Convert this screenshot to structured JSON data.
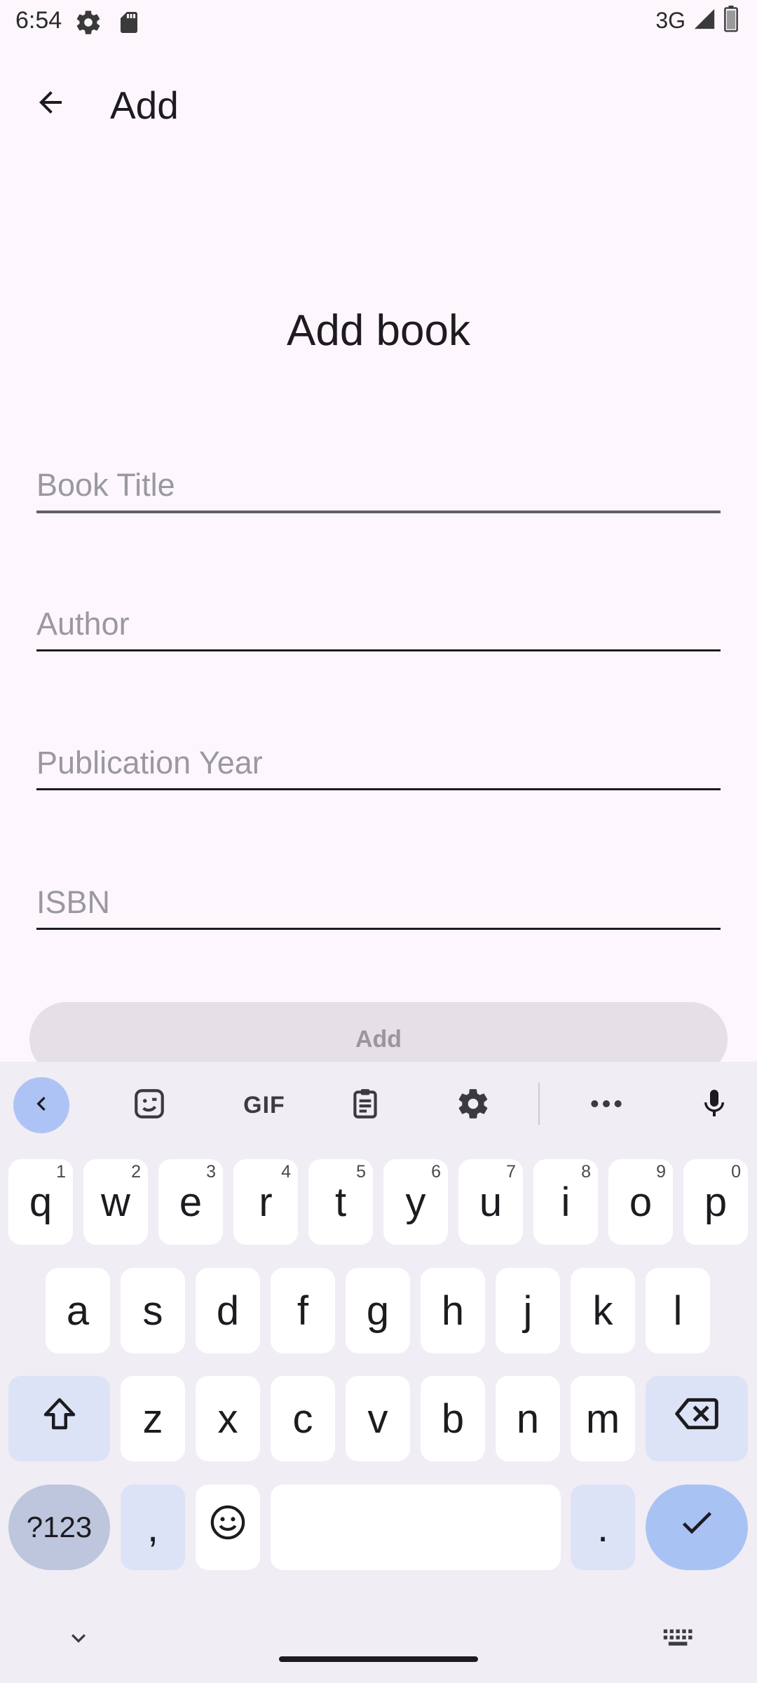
{
  "status_bar": {
    "time": "6:54",
    "network": "3G",
    "icons": [
      "gear-icon",
      "sd-card-icon",
      "signal-icon",
      "battery-icon"
    ]
  },
  "app_bar": {
    "title": "Add",
    "back_icon": "arrow-back-icon"
  },
  "form": {
    "heading": "Add book",
    "fields": [
      {
        "name": "book-title-field",
        "placeholder": "Book Title",
        "value": "",
        "focused": true
      },
      {
        "name": "author-field",
        "placeholder": "Author",
        "value": ""
      },
      {
        "name": "publication-year-field",
        "placeholder": "Publication Year",
        "value": ""
      },
      {
        "name": "isbn-field",
        "placeholder": "ISBN",
        "value": ""
      }
    ],
    "submit_label": "Add"
  },
  "keyboard": {
    "toolbar": {
      "gif_label": "GIF",
      "icons": [
        "chevron-left-icon",
        "sticker-icon",
        "gif-icon",
        "clipboard-icon",
        "settings-icon",
        "more-icon",
        "mic-icon"
      ]
    },
    "row1": [
      {
        "k": "q",
        "h": "1"
      },
      {
        "k": "w",
        "h": "2"
      },
      {
        "k": "e",
        "h": "3"
      },
      {
        "k": "r",
        "h": "4"
      },
      {
        "k": "t",
        "h": "5"
      },
      {
        "k": "y",
        "h": "6"
      },
      {
        "k": "u",
        "h": "7"
      },
      {
        "k": "i",
        "h": "8"
      },
      {
        "k": "o",
        "h": "9"
      },
      {
        "k": "p",
        "h": "0"
      }
    ],
    "row2": [
      "a",
      "s",
      "d",
      "f",
      "g",
      "h",
      "j",
      "k",
      "l"
    ],
    "row3": [
      "z",
      "x",
      "c",
      "v",
      "b",
      "n",
      "m"
    ],
    "symbols_label": "?123",
    "comma": ",",
    "period": ".",
    "colors": {
      "accent": "#a9c2f4",
      "modifier": "#dde3f7",
      "key": "#ffffff",
      "background": "#f0edf4"
    }
  },
  "colors": {
    "background": "#fdf7fd",
    "button_disabled": "#e5dfe6",
    "text": "#1d1b20"
  }
}
